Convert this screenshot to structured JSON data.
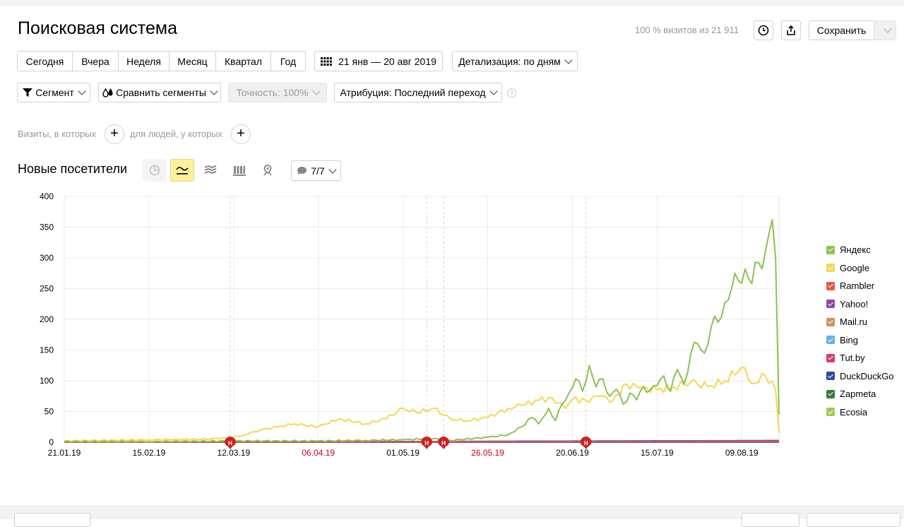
{
  "page": {
    "title": "Поисковая система",
    "visits_info": "100 % визитов из 21 911",
    "save_label": "Сохранить"
  },
  "periods": [
    "Сегодня",
    "Вчера",
    "Неделя",
    "Месяц",
    "Квартал",
    "Год"
  ],
  "date_range": "21 янв — 20 авг 2019",
  "detail": "Детализация: по дням",
  "filters": {
    "segment": "Сегмент",
    "compare": "Сравнить сегменты",
    "accuracy": "Точность: 100%",
    "attribution": "Атрибуция: Последний переход",
    "help": "?",
    "visits_condition": "Визиты, в которых",
    "people_condition": "для людей, у которых"
  },
  "report": {
    "subtitle": "Новые посетители",
    "annotations_count": "7/7"
  },
  "colors": {
    "yandex": "#8dc152",
    "google": "#f6d654",
    "highlight": "#d0021b",
    "marker": "#cc2222"
  },
  "chart_data": {
    "type": "line",
    "ylim": [
      0,
      400
    ],
    "y_ticks": [
      "0",
      "50",
      "100",
      "150",
      "200",
      "250",
      "300",
      "350",
      "400"
    ],
    "y_tick_values": [
      0,
      50,
      100,
      150,
      200,
      250,
      300,
      350,
      400
    ],
    "x_ticks": [
      {
        "label": "21.01.19",
        "date": "2019-01-21",
        "highlight": false
      },
      {
        "label": "15.02.19",
        "date": "2019-02-15",
        "highlight": false
      },
      {
        "label": "12.03.19",
        "date": "2019-03-12",
        "highlight": false
      },
      {
        "label": "06.04.19",
        "date": "2019-04-06",
        "highlight": true
      },
      {
        "label": "01.05.19",
        "date": "2019-05-01",
        "highlight": false
      },
      {
        "label": "26.05.19",
        "date": "2019-05-26",
        "highlight": true
      },
      {
        "label": "20.06.19",
        "date": "2019-06-20",
        "highlight": false
      },
      {
        "label": "15.07.19",
        "date": "2019-07-15",
        "highlight": false
      },
      {
        "label": "09.08.19",
        "date": "2019-08-09",
        "highlight": false
      }
    ],
    "x_start": "2019-01-21",
    "x_end": "2019-08-20",
    "grid": true,
    "legend_position": "right",
    "annotations": [
      {
        "date": "2019-03-11",
        "label": "H"
      },
      {
        "date": "2019-05-08",
        "label": "H"
      },
      {
        "date": "2019-05-13",
        "label": "H"
      },
      {
        "date": "2019-06-24",
        "label": "H"
      }
    ],
    "series": [
      {
        "name": "Яндекс",
        "color": "#8dc152",
        "points": [
          [
            "2019-01-21",
            1
          ],
          [
            "2019-02-15",
            1
          ],
          [
            "2019-03-12",
            2
          ],
          [
            "2019-04-06",
            2
          ],
          [
            "2019-04-20",
            3
          ],
          [
            "2019-05-01",
            4
          ],
          [
            "2019-05-10",
            6
          ],
          [
            "2019-05-15",
            3
          ],
          [
            "2019-05-26",
            8
          ],
          [
            "2019-06-01",
            12
          ],
          [
            "2019-06-05",
            25
          ],
          [
            "2019-06-08",
            40
          ],
          [
            "2019-06-10",
            30
          ],
          [
            "2019-06-13",
            55
          ],
          [
            "2019-06-15",
            35
          ],
          [
            "2019-06-17",
            62
          ],
          [
            "2019-06-19",
            80
          ],
          [
            "2019-06-21",
            103
          ],
          [
            "2019-06-23",
            83
          ],
          [
            "2019-06-25",
            125
          ],
          [
            "2019-06-27",
            90
          ],
          [
            "2019-06-29",
            103
          ],
          [
            "2019-07-01",
            75
          ],
          [
            "2019-07-03",
            86
          ],
          [
            "2019-07-05",
            62
          ],
          [
            "2019-07-07",
            80
          ],
          [
            "2019-07-09",
            69
          ],
          [
            "2019-07-11",
            90
          ],
          [
            "2019-07-13",
            85
          ],
          [
            "2019-07-15",
            92
          ],
          [
            "2019-07-17",
            108
          ],
          [
            "2019-07-19",
            83
          ],
          [
            "2019-07-21",
            118
          ],
          [
            "2019-07-23",
            95
          ],
          [
            "2019-07-25",
            145
          ],
          [
            "2019-07-27",
            160
          ],
          [
            "2019-07-29",
            145
          ],
          [
            "2019-07-31",
            188
          ],
          [
            "2019-08-02",
            195
          ],
          [
            "2019-08-04",
            227
          ],
          [
            "2019-08-06",
            250
          ],
          [
            "2019-08-08",
            263
          ],
          [
            "2019-08-10",
            282
          ],
          [
            "2019-08-12",
            258
          ],
          [
            "2019-08-14",
            292
          ],
          [
            "2019-08-16",
            310
          ],
          [
            "2019-08-18",
            362
          ],
          [
            "2019-08-19",
            300
          ],
          [
            "2019-08-20",
            45
          ]
        ]
      },
      {
        "name": "Google",
        "color": "#f6d654",
        "points": [
          [
            "2019-01-21",
            2
          ],
          [
            "2019-02-15",
            4
          ],
          [
            "2019-03-05",
            5
          ],
          [
            "2019-03-12",
            8
          ],
          [
            "2019-03-15",
            12
          ],
          [
            "2019-03-20",
            20
          ],
          [
            "2019-03-25",
            25
          ],
          [
            "2019-03-30",
            30
          ],
          [
            "2019-04-06",
            25
          ],
          [
            "2019-04-12",
            38
          ],
          [
            "2019-04-20",
            30
          ],
          [
            "2019-04-26",
            38
          ],
          [
            "2019-05-01",
            55
          ],
          [
            "2019-05-05",
            48
          ],
          [
            "2019-05-10",
            55
          ],
          [
            "2019-05-15",
            38
          ],
          [
            "2019-05-20",
            35
          ],
          [
            "2019-05-26",
            40
          ],
          [
            "2019-06-01",
            55
          ],
          [
            "2019-06-05",
            60
          ],
          [
            "2019-06-10",
            68
          ],
          [
            "2019-06-14",
            72
          ],
          [
            "2019-06-18",
            55
          ],
          [
            "2019-06-20",
            70
          ],
          [
            "2019-06-24",
            68
          ],
          [
            "2019-06-28",
            75
          ],
          [
            "2019-07-02",
            68
          ],
          [
            "2019-07-06",
            95
          ],
          [
            "2019-07-10",
            88
          ],
          [
            "2019-07-15",
            85
          ],
          [
            "2019-07-20",
            90
          ],
          [
            "2019-07-25",
            98
          ],
          [
            "2019-07-30",
            90
          ],
          [
            "2019-08-04",
            100
          ],
          [
            "2019-08-09",
            122
          ],
          [
            "2019-08-12",
            95
          ],
          [
            "2019-08-16",
            108
          ],
          [
            "2019-08-19",
            85
          ],
          [
            "2019-08-20",
            15
          ]
        ]
      },
      {
        "name": "Rambler",
        "color": "#e8583e",
        "points": [
          [
            "2019-01-21",
            0
          ],
          [
            "2019-08-20",
            2
          ]
        ]
      },
      {
        "name": "Yahoo!",
        "color": "#8e44ad",
        "points": [
          [
            "2019-01-21",
            0
          ],
          [
            "2019-08-20",
            0
          ]
        ]
      },
      {
        "name": "Mail.ru",
        "color": "#d1915b",
        "points": [
          [
            "2019-01-21",
            0
          ],
          [
            "2019-08-20",
            1
          ]
        ]
      },
      {
        "name": "Bing",
        "color": "#6aaee3",
        "points": [
          [
            "2019-01-21",
            0
          ],
          [
            "2019-08-20",
            2
          ]
        ]
      },
      {
        "name": "Tut.by",
        "color": "#d63d6b",
        "points": [
          [
            "2019-01-21",
            0
          ],
          [
            "2019-08-20",
            0
          ]
        ]
      },
      {
        "name": "DuckDuckGo",
        "color": "#2b4ea0",
        "points": [
          [
            "2019-01-21",
            0
          ],
          [
            "2019-08-20",
            3
          ]
        ]
      },
      {
        "name": "Zapmeta",
        "color": "#2f7d3e",
        "points": [
          [
            "2019-01-21",
            0
          ],
          [
            "2019-08-20",
            0
          ]
        ]
      },
      {
        "name": "Ecosia",
        "color": "#9ccc55",
        "points": [
          [
            "2019-01-21",
            0
          ],
          [
            "2019-08-20",
            0
          ]
        ]
      }
    ]
  }
}
